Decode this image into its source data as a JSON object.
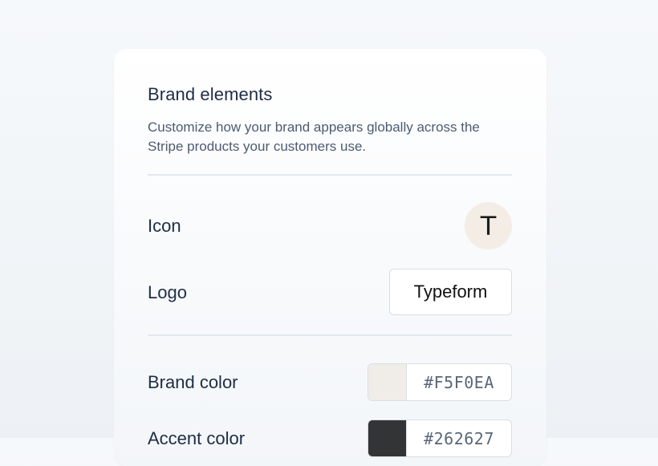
{
  "section": {
    "title": "Brand elements",
    "description": "Customize how your brand appears globally across the Stripe products your customers use."
  },
  "icon_row": {
    "label": "Icon",
    "icon_letter": "T",
    "icon_bg": "#F3EDE5"
  },
  "logo_row": {
    "label": "Logo",
    "logo_text": "Typeform"
  },
  "brand_color": {
    "label": "Brand color",
    "value": "#F5F0EA",
    "swatch": "#F0ECE8"
  },
  "accent_color": {
    "label": "Accent color",
    "value": "#262627",
    "swatch": "#333435"
  }
}
